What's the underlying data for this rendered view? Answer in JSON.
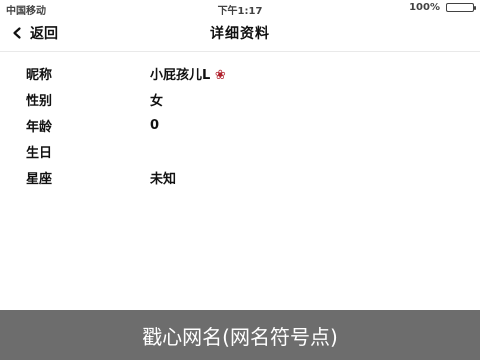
{
  "status_bar": {
    "left": "中国移动",
    "center": "下午1:17",
    "right": "100%"
  },
  "nav": {
    "back_label": "返回",
    "title": "详细资料"
  },
  "profile": {
    "rows": [
      {
        "label": "昵称",
        "value": "小屁孩儿L",
        "value_suffix": "❀"
      },
      {
        "label": "性别",
        "value": "女"
      },
      {
        "label": "年龄",
        "value": "0"
      },
      {
        "label": "生日",
        "value": ""
      },
      {
        "label": "星座",
        "value": "未知"
      }
    ]
  },
  "caption": "戳心网名(网名符号点)"
}
